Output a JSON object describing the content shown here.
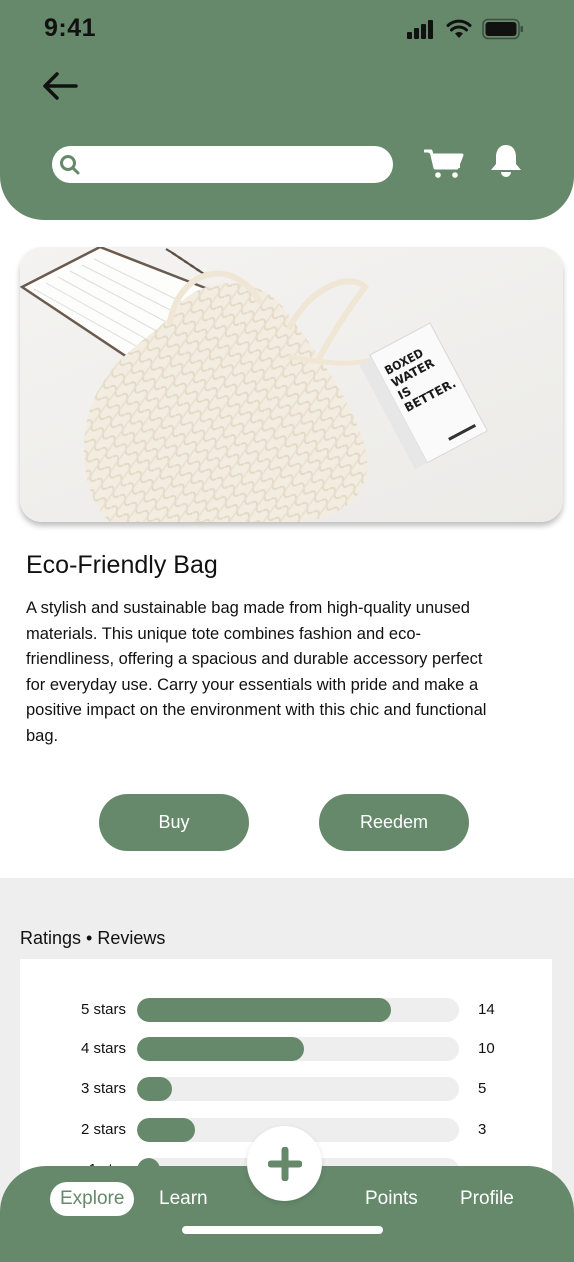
{
  "status_bar": {
    "time": "9:41"
  },
  "header": {
    "search": {
      "placeholder": ""
    }
  },
  "product": {
    "image_text": "BOXED WATER IS BETTER.",
    "title": "Eco-Friendly Bag",
    "description": "A stylish and sustainable bag made from high-quality unused materials. This unique tote combines fashion and eco-friendliness, offering a spacious and durable accessory perfect for everyday use. Carry your essentials with pride and make a positive impact on the environment with this chic and functional bag."
  },
  "actions": {
    "buy_label": "Buy",
    "redeem_label": "Reedem"
  },
  "reviews": {
    "heading": "Ratings • Reviews",
    "rows": [
      {
        "label": "5 stars",
        "fill": 0.79,
        "count": "14"
      },
      {
        "label": "4 stars",
        "fill": 0.52,
        "count": "10"
      },
      {
        "label": "3 stars",
        "fill": 0.11,
        "count": "5"
      },
      {
        "label": "2 stars",
        "fill": 0.18,
        "count": "3"
      },
      {
        "label": "1 star",
        "fill": 0.07,
        "count": ""
      }
    ]
  },
  "bottom_nav": {
    "items": [
      {
        "label": "Explore",
        "active": true
      },
      {
        "label": "Learn",
        "active": false
      },
      {
        "label": "Points",
        "active": false
      },
      {
        "label": "Profile",
        "active": false
      }
    ]
  },
  "colors": {
    "brand_green": "#66896c",
    "section_gray": "#eeeeee"
  },
  "icons": [
    "back-arrow-icon",
    "search-icon",
    "cart-icon",
    "bell-icon",
    "plus-icon",
    "signal-icon",
    "wifi-icon",
    "battery-icon"
  ]
}
